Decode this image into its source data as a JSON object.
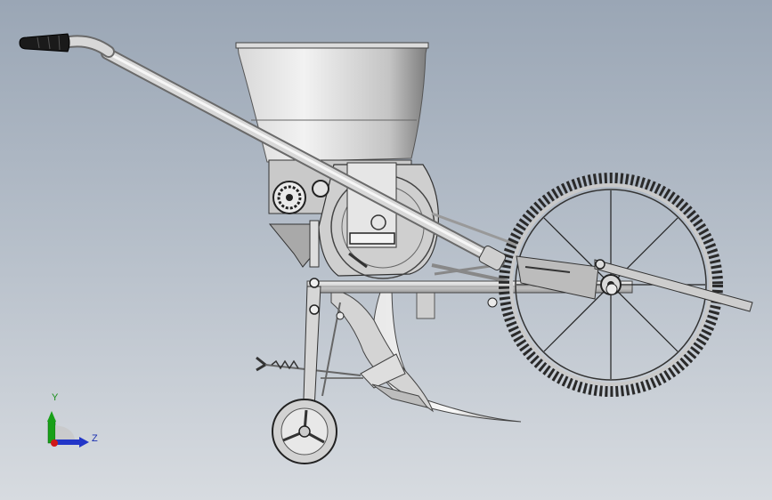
{
  "triad": {
    "y_label": "Y",
    "z_label": "Z"
  },
  "colors": {
    "background_top": "#9aa6b5",
    "background_bottom": "#d7dbe0",
    "y_axis": "#18a018",
    "z_axis": "#2236c8",
    "x_origin": "#d01818",
    "grip": "#1a1a1a"
  }
}
